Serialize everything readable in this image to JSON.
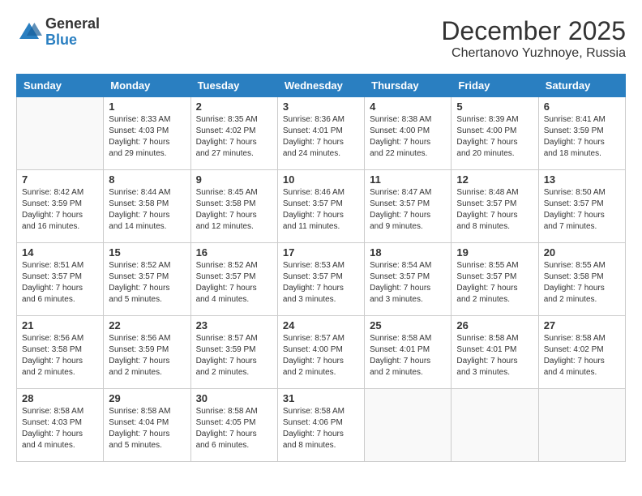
{
  "logo": {
    "general": "General",
    "blue": "Blue"
  },
  "header": {
    "month": "December 2025",
    "location": "Chertanovo Yuzhnoye, Russia"
  },
  "days_of_week": [
    "Sunday",
    "Monday",
    "Tuesday",
    "Wednesday",
    "Thursday",
    "Friday",
    "Saturday"
  ],
  "weeks": [
    [
      {
        "day": "",
        "info": ""
      },
      {
        "day": "1",
        "info": "Sunrise: 8:33 AM\nSunset: 4:03 PM\nDaylight: 7 hours\nand 29 minutes."
      },
      {
        "day": "2",
        "info": "Sunrise: 8:35 AM\nSunset: 4:02 PM\nDaylight: 7 hours\nand 27 minutes."
      },
      {
        "day": "3",
        "info": "Sunrise: 8:36 AM\nSunset: 4:01 PM\nDaylight: 7 hours\nand 24 minutes."
      },
      {
        "day": "4",
        "info": "Sunrise: 8:38 AM\nSunset: 4:00 PM\nDaylight: 7 hours\nand 22 minutes."
      },
      {
        "day": "5",
        "info": "Sunrise: 8:39 AM\nSunset: 4:00 PM\nDaylight: 7 hours\nand 20 minutes."
      },
      {
        "day": "6",
        "info": "Sunrise: 8:41 AM\nSunset: 3:59 PM\nDaylight: 7 hours\nand 18 minutes."
      }
    ],
    [
      {
        "day": "7",
        "info": "Sunrise: 8:42 AM\nSunset: 3:59 PM\nDaylight: 7 hours\nand 16 minutes."
      },
      {
        "day": "8",
        "info": "Sunrise: 8:44 AM\nSunset: 3:58 PM\nDaylight: 7 hours\nand 14 minutes."
      },
      {
        "day": "9",
        "info": "Sunrise: 8:45 AM\nSunset: 3:58 PM\nDaylight: 7 hours\nand 12 minutes."
      },
      {
        "day": "10",
        "info": "Sunrise: 8:46 AM\nSunset: 3:57 PM\nDaylight: 7 hours\nand 11 minutes."
      },
      {
        "day": "11",
        "info": "Sunrise: 8:47 AM\nSunset: 3:57 PM\nDaylight: 7 hours\nand 9 minutes."
      },
      {
        "day": "12",
        "info": "Sunrise: 8:48 AM\nSunset: 3:57 PM\nDaylight: 7 hours\nand 8 minutes."
      },
      {
        "day": "13",
        "info": "Sunrise: 8:50 AM\nSunset: 3:57 PM\nDaylight: 7 hours\nand 7 minutes."
      }
    ],
    [
      {
        "day": "14",
        "info": "Sunrise: 8:51 AM\nSunset: 3:57 PM\nDaylight: 7 hours\nand 6 minutes."
      },
      {
        "day": "15",
        "info": "Sunrise: 8:52 AM\nSunset: 3:57 PM\nDaylight: 7 hours\nand 5 minutes."
      },
      {
        "day": "16",
        "info": "Sunrise: 8:52 AM\nSunset: 3:57 PM\nDaylight: 7 hours\nand 4 minutes."
      },
      {
        "day": "17",
        "info": "Sunrise: 8:53 AM\nSunset: 3:57 PM\nDaylight: 7 hours\nand 3 minutes."
      },
      {
        "day": "18",
        "info": "Sunrise: 8:54 AM\nSunset: 3:57 PM\nDaylight: 7 hours\nand 3 minutes."
      },
      {
        "day": "19",
        "info": "Sunrise: 8:55 AM\nSunset: 3:57 PM\nDaylight: 7 hours\nand 2 minutes."
      },
      {
        "day": "20",
        "info": "Sunrise: 8:55 AM\nSunset: 3:58 PM\nDaylight: 7 hours\nand 2 minutes."
      }
    ],
    [
      {
        "day": "21",
        "info": "Sunrise: 8:56 AM\nSunset: 3:58 PM\nDaylight: 7 hours\nand 2 minutes."
      },
      {
        "day": "22",
        "info": "Sunrise: 8:56 AM\nSunset: 3:59 PM\nDaylight: 7 hours\nand 2 minutes."
      },
      {
        "day": "23",
        "info": "Sunrise: 8:57 AM\nSunset: 3:59 PM\nDaylight: 7 hours\nand 2 minutes."
      },
      {
        "day": "24",
        "info": "Sunrise: 8:57 AM\nSunset: 4:00 PM\nDaylight: 7 hours\nand 2 minutes."
      },
      {
        "day": "25",
        "info": "Sunrise: 8:58 AM\nSunset: 4:01 PM\nDaylight: 7 hours\nand 2 minutes."
      },
      {
        "day": "26",
        "info": "Sunrise: 8:58 AM\nSunset: 4:01 PM\nDaylight: 7 hours\nand 3 minutes."
      },
      {
        "day": "27",
        "info": "Sunrise: 8:58 AM\nSunset: 4:02 PM\nDaylight: 7 hours\nand 4 minutes."
      }
    ],
    [
      {
        "day": "28",
        "info": "Sunrise: 8:58 AM\nSunset: 4:03 PM\nDaylight: 7 hours\nand 4 minutes."
      },
      {
        "day": "29",
        "info": "Sunrise: 8:58 AM\nSunset: 4:04 PM\nDaylight: 7 hours\nand 5 minutes."
      },
      {
        "day": "30",
        "info": "Sunrise: 8:58 AM\nSunset: 4:05 PM\nDaylight: 7 hours\nand 6 minutes."
      },
      {
        "day": "31",
        "info": "Sunrise: 8:58 AM\nSunset: 4:06 PM\nDaylight: 7 hours\nand 8 minutes."
      },
      {
        "day": "",
        "info": ""
      },
      {
        "day": "",
        "info": ""
      },
      {
        "day": "",
        "info": ""
      }
    ]
  ]
}
